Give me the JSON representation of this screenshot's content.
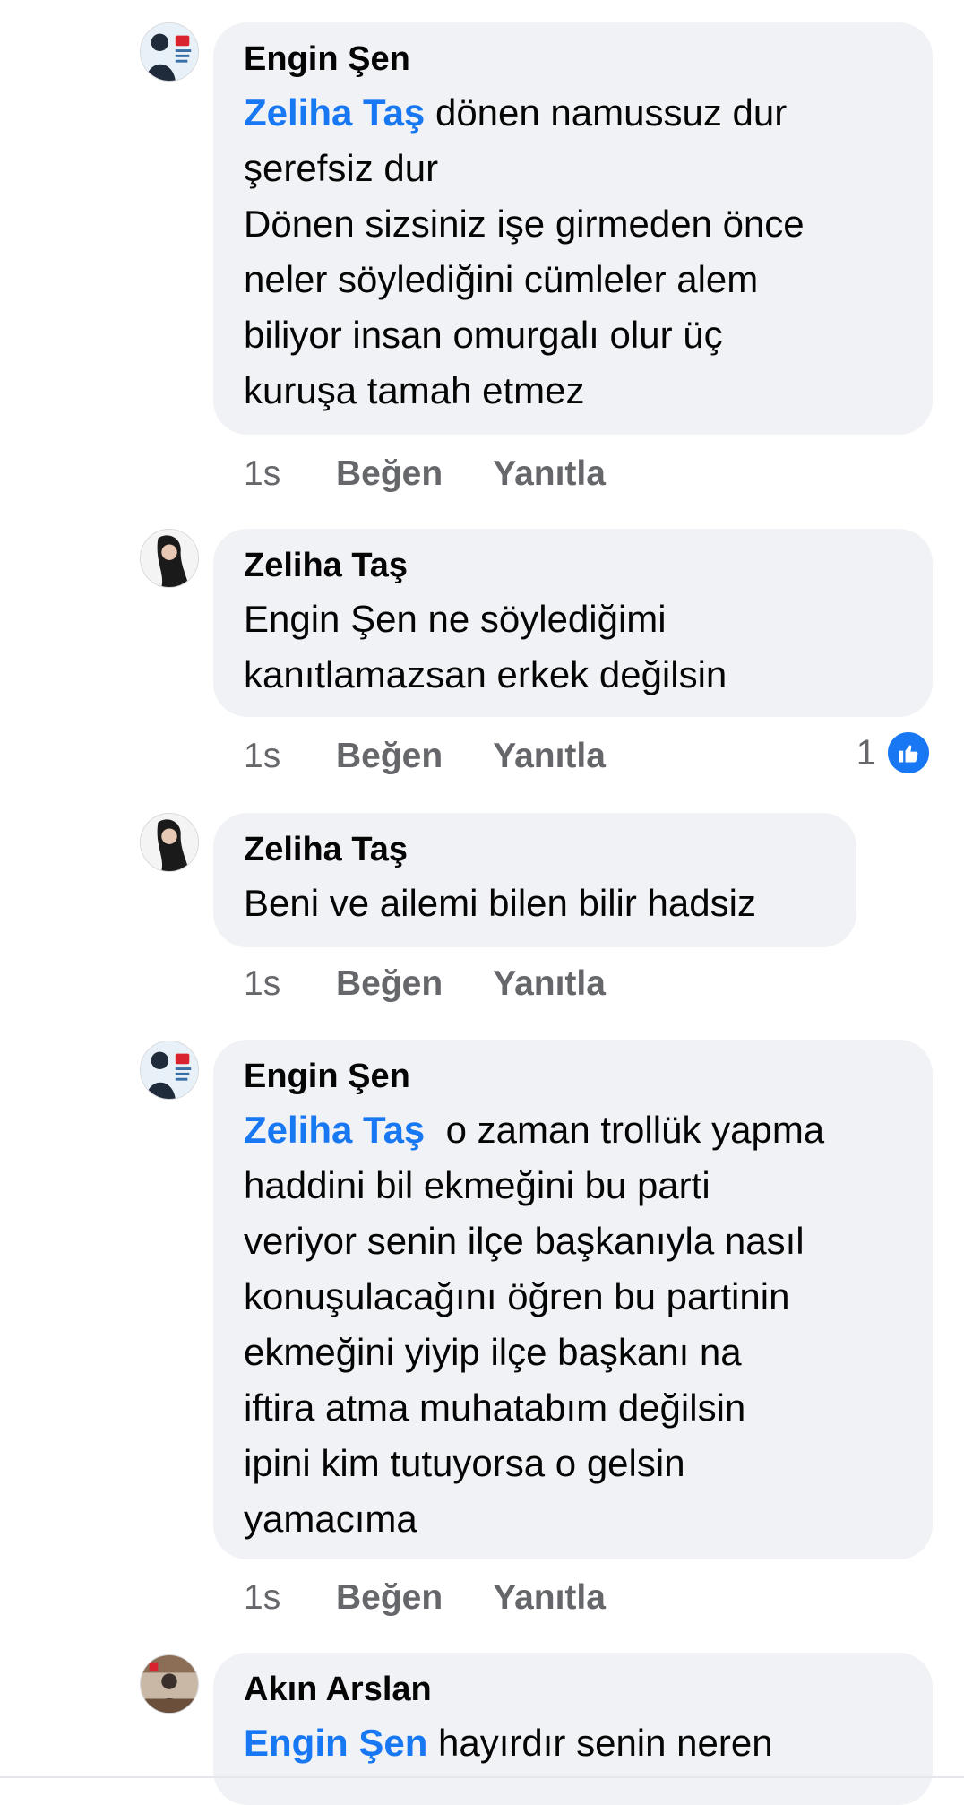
{
  "comments": [
    {
      "author": "Engin Şen",
      "mention": "Zeliha Taş",
      "text_after_mention": " dönen namussuz dur",
      "lines": [
        "şerefsiz dur",
        "Dönen sizsiniz işe girmeden önce",
        "neler söylediğini cümleler alem",
        "biliyor insan omurgalı olur üç",
        "kuruşa tamah etmez"
      ],
      "time": "1s",
      "like": "Beğen",
      "reply": "Yanıtla",
      "avatar": "chp-avatar-icon"
    },
    {
      "author": "Zeliha Taş",
      "lines": [
        "Engin Şen ne söylediğimi",
        "kanıtlamazsan erkek değilsin"
      ],
      "time": "1s",
      "like": "Beğen",
      "reply": "Yanıtla",
      "reaction_count": "1",
      "reaction_icon": "like-thumb-icon",
      "avatar": "woman-avatar-icon"
    },
    {
      "author": "Zeliha Taş",
      "lines": [
        "Beni ve ailemi bilen bilir hadsiz"
      ],
      "time": "1s",
      "like": "Beğen",
      "reply": "Yanıtla",
      "avatar": "woman-avatar-icon"
    },
    {
      "author": "Engin Şen",
      "mention": "Zeliha Taş",
      "text_after_mention": "  o zaman trollük yapma",
      "lines": [
        "haddini bil ekmeğini bu parti",
        "veriyor senin ilçe başkanıyla nasıl",
        "konuşulacağını öğren bu partinin",
        "ekmeğini yiyip ilçe başkanı na",
        "iftira atma muhatabım değilsin",
        "ipini kim tutuyorsa o gelsin",
        "yamacıma"
      ],
      "time": "1s",
      "like": "Beğen",
      "reply": "Yanıtla",
      "avatar": "chp-avatar-icon"
    },
    {
      "author": "Akın Arslan",
      "mention": "Engin Şen",
      "text_after_mention": " hayırdır senin neren",
      "avatar": "office-avatar-icon"
    }
  ],
  "colors": {
    "bubble": "#f0f2f5",
    "mention": "#1877f2",
    "meta": "#65676b",
    "text": "#050505"
  }
}
